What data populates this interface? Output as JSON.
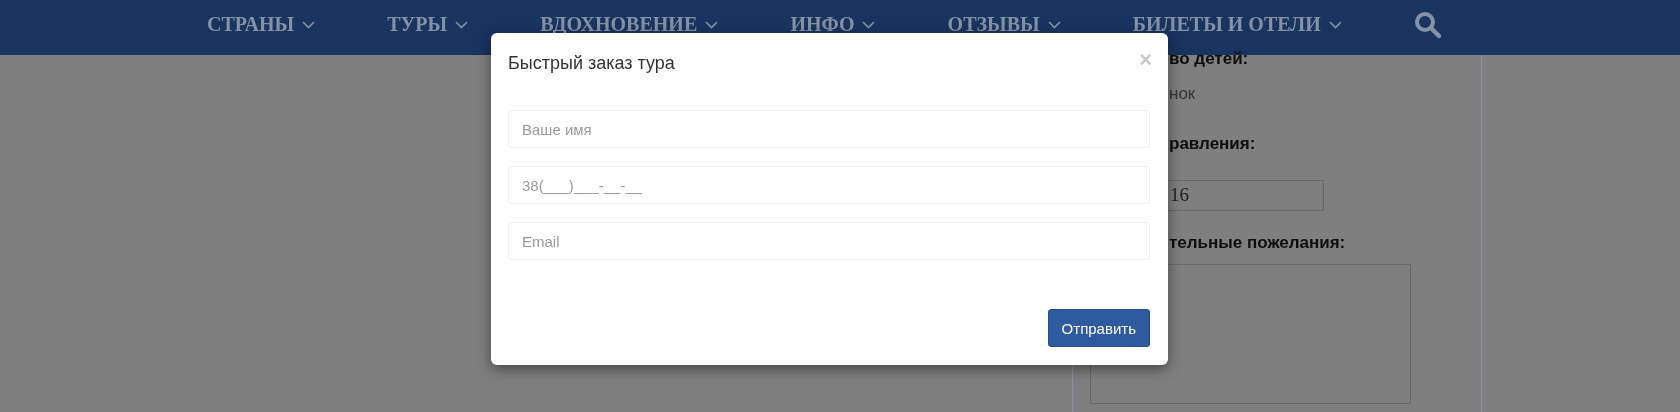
{
  "nav": {
    "items": [
      {
        "label": "СТРАНЫ",
        "has_dropdown": true
      },
      {
        "label": "ТУРЫ",
        "has_dropdown": true
      },
      {
        "label": "ВДОХНОВЕНИЕ",
        "has_dropdown": true
      },
      {
        "label": "ИНФО",
        "has_dropdown": true
      },
      {
        "label": "ОТЗЫВЫ",
        "has_dropdown": true
      },
      {
        "label": "БИЛЕТЫ И ОТЕЛИ",
        "has_dropdown": true
      }
    ]
  },
  "background_form": {
    "children_label": "во детей:",
    "children_value": "нок",
    "departure_label": "равления:",
    "departure_value": "16",
    "wishes_label": "тельные пожелания:"
  },
  "modal": {
    "title": "Быстрый заказ тура",
    "close": "×",
    "fields": [
      {
        "placeholder": "Ваше имя"
      },
      {
        "placeholder": "38(___)___-__-__"
      },
      {
        "placeholder": "Email"
      }
    ],
    "button": "Отправить"
  }
}
